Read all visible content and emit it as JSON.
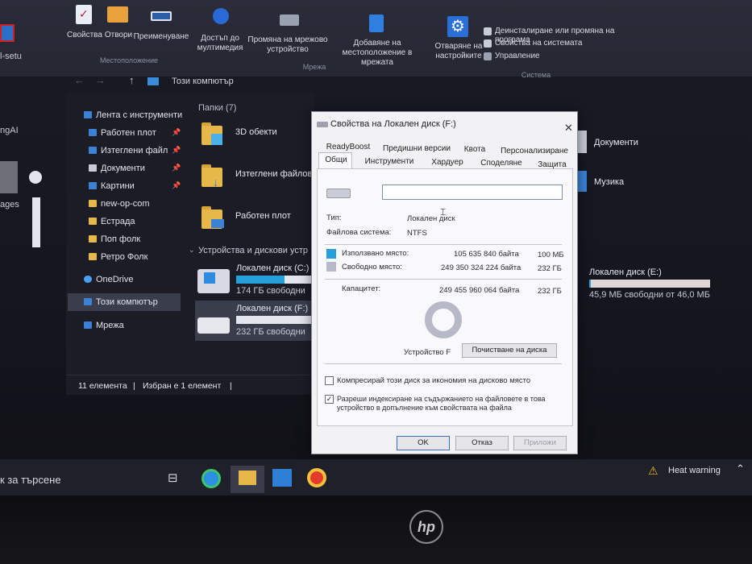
{
  "ribbon": {
    "properties": "Свойства",
    "open": "Отвори",
    "rename": "Преименуване",
    "group_location": "Местоположение",
    "media_access": "Достъп до мултимедия",
    "map_drive": "Промяна на мрежово устройство",
    "add_location": "Добавяне на местоположение в мрежата",
    "open_settings": "Отваряне на настройките",
    "group_network": "Мрежа",
    "uninstall": "Деинсталиране или промяна на програма",
    "system_props": "Свойства на системата",
    "manage": "Управление",
    "group_system": "Система"
  },
  "address": {
    "path": "Този компютър"
  },
  "desktop": {
    "setup_label": "l-setu",
    "ai_label": "ngAI",
    "ages_label": "ages"
  },
  "nav": {
    "quick_access": "Лента с инструменти",
    "desktop": "Работен плот",
    "downloads": "Изтеглени файл",
    "documents": "Документи",
    "pictures": "Картини",
    "new_op": "new-op-com",
    "estrada": "Естрада",
    "pop_folk": "Поп фолк",
    "retro_folk": "Ретро Фолк",
    "onedrive": "OneDrive",
    "this_pc": "Този компютър",
    "network": "Мрежа"
  },
  "content": {
    "folders_header": "Папки (7)",
    "f_3d": "3D обекти",
    "f_downloads": "Изтеглени файлов",
    "f_desktop": "Работен плот",
    "f_documents": "Документи",
    "f_music": "Музика",
    "devices_header": "Устройства и дискови устр",
    "drive_c_name": "Локален диск (C:)",
    "drive_c_free": "174 ГБ свободни",
    "drive_c_fill": 0.6,
    "drive_f_name": "Локален диск (F:)",
    "drive_f_free": "232 ГБ свободни",
    "drive_f_fill": 0.0,
    "drive_e_name": "Локален диск (E:)",
    "drive_e_free": "45,9 МБ свободни от 46,0 МБ",
    "drive_e_fill": 0.01
  },
  "status": {
    "items": "11 елемента",
    "selected": "Избран е 1 елемент"
  },
  "dialog": {
    "title": "Свойства на Локален диск (F:)",
    "tabs_row1": [
      "ReadyBoost",
      "Предишни версии",
      "Квота",
      "Персонализиране"
    ],
    "tabs_row2": [
      "Общи",
      "Инструменти",
      "Хардуер",
      "Споделяне",
      "Защита"
    ],
    "name_value": "",
    "type_label": "Тип:",
    "type_value": "Локален диск",
    "fs_label": "Файлова система:",
    "fs_value": "NTFS",
    "used_label": "Използвано място:",
    "used_bytes": "105 635 840 байта",
    "used_size": "100 МБ",
    "free_label": "Свободно място:",
    "free_bytes": "249 350 324 224 байта",
    "free_size": "232 ГБ",
    "cap_label": "Капацитет:",
    "cap_bytes": "249 455 960 064 байта",
    "cap_size": "232 ГБ",
    "drive_label": "Устройство F",
    "cleanup": "Почистване на диска",
    "compress": "Компресирай този диск за икономия на дисково място",
    "index": "Разреши индексиране на съдържанието на файловете в това устройство в допълнение към свойствата на файла",
    "ok": "OK",
    "cancel": "Отказ",
    "apply": "Приложи",
    "used_color": "#26a0da",
    "free_color": "#b7b9c8"
  },
  "taskbar": {
    "search": "к за търсене",
    "heat": "Heat warning"
  },
  "logo": "hp"
}
